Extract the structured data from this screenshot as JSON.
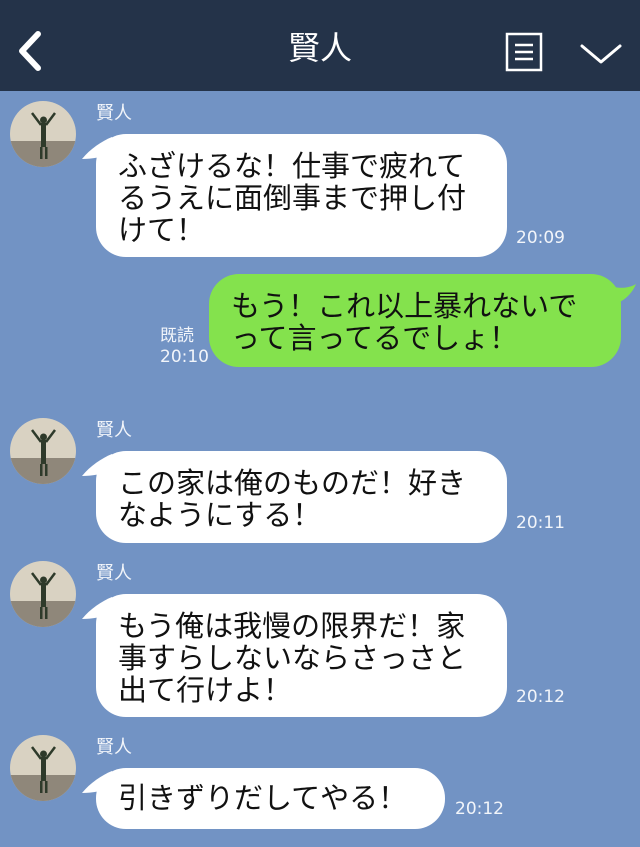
{
  "header": {
    "title": "賢人",
    "back_icon": "chevron-left-icon",
    "menu_icon": "notes-icon",
    "collapse_icon": "chevron-down-icon",
    "background": "#243349"
  },
  "chat": {
    "background": "#7293c4",
    "incoming_bubble_color": "#ffffff",
    "outgoing_bubble_color": "#84e24d",
    "messages": [
      {
        "direction": "incoming",
        "sender": "賢人",
        "lines": [
          "ふざけるな！仕事で疲れて",
          "るうえに面倒事まで押し付",
          "けて！"
        ],
        "time": "20:09"
      },
      {
        "direction": "outgoing",
        "lines": [
          "もう！これ以上暴れないで",
          "って言ってるでしょ！"
        ],
        "read_label": "既読",
        "time": "20:10"
      },
      {
        "direction": "incoming",
        "sender": "賢人",
        "lines": [
          "この家は俺のものだ！好き",
          "なようにする！"
        ],
        "time": "20:11"
      },
      {
        "direction": "incoming",
        "sender": "賢人",
        "lines": [
          "もう俺は我慢の限界だ！家",
          "事すらしないならさっさと",
          "出て行けよ！"
        ],
        "time": "20:12"
      },
      {
        "direction": "incoming",
        "sender": "賢人",
        "lines": [
          "引きずりだしてやる！"
        ],
        "time": "20:12"
      }
    ]
  }
}
